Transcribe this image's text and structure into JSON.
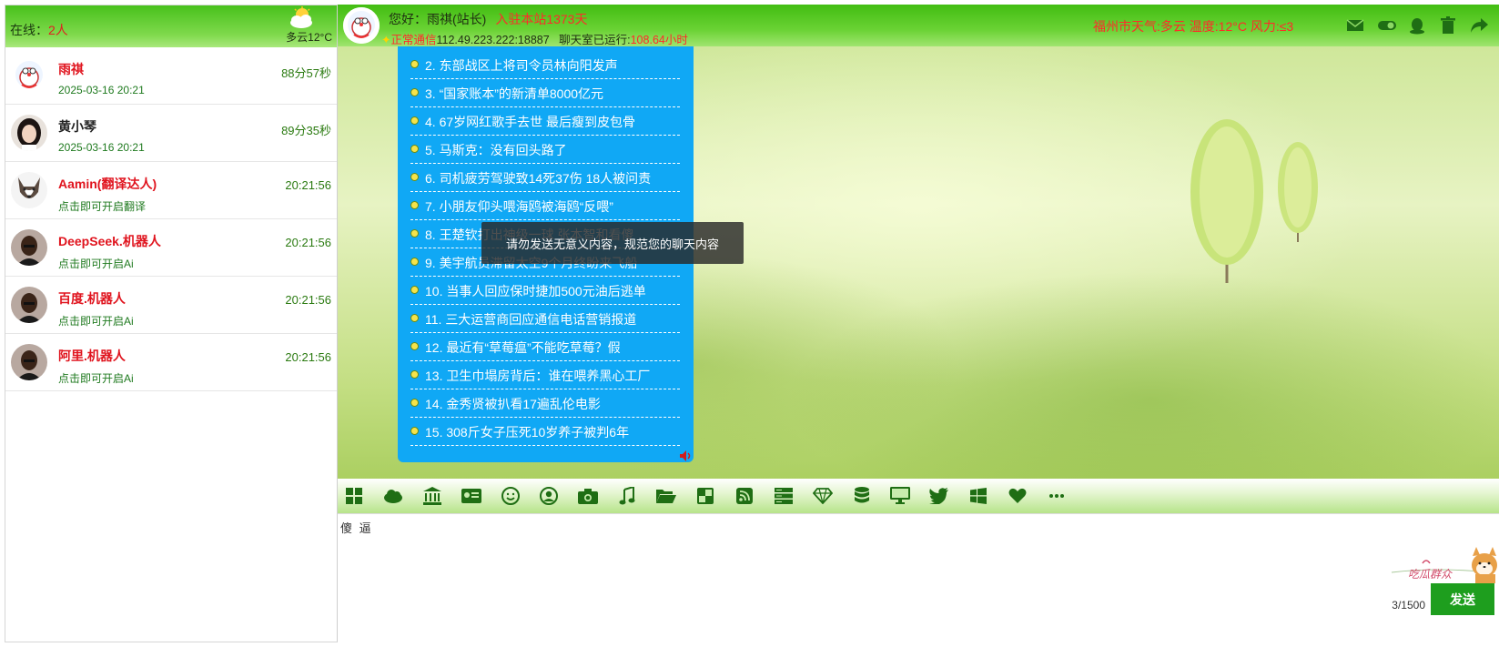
{
  "sidebar": {
    "online_label": "在线：",
    "online_count": "2人",
    "weather": "多云12°C",
    "users": [
      {
        "name": "雨祺",
        "sub": "2025-03-16 20:21",
        "time": "88分57秒",
        "name_color": "red"
      },
      {
        "name": "黄小琴",
        "sub": "2025-03-16 20:21",
        "time": "89分35秒",
        "name_color": "black"
      },
      {
        "name": "Aamin(翻译达人)",
        "sub": "点击即可开启翻译",
        "time": "20:21:56",
        "name_color": "red"
      },
      {
        "name": "DeepSeek.机器人",
        "sub": "点击即可开启Ai",
        "time": "20:21:56",
        "name_color": "red"
      },
      {
        "name": "百度.机器人",
        "sub": "点击即可开启Ai",
        "time": "20:21:56",
        "name_color": "red"
      },
      {
        "name": "阿里.机器人",
        "sub": "点击即可开启Ai",
        "time": "20:21:56",
        "name_color": "red"
      }
    ]
  },
  "header": {
    "greeting": "您好：雨祺(站长)",
    "days": "入驻本站1373天",
    "status_ok": "正常通信",
    "ip": "112.49.223.222:18887",
    "runtime_label": "聊天室已运行:",
    "runtime_value": "108.64小时",
    "weather_line": "福州市天气:多云 温度:12°C 风力:≤3",
    "tool_icons": [
      "mail-icon",
      "toggle-icon",
      "qq-icon",
      "trash-icon",
      "share-icon"
    ]
  },
  "news": [
    "2. 东部战区上将司令员林向阳发声",
    "3. “国家账本”的新清单8000亿元",
    "4. 67岁网红歌手去世 最后瘦到皮包骨",
    "5. 马斯克：没有回头路了",
    "6. 司机疲劳驾驶致14死37伤 18人被问责",
    "7. 小朋友仰头喂海鸥被海鸥“反喂”",
    "8. 王楚钦打出神级一球 张本智和看傻",
    "9. 美宇航员滞留太空9个月终盼来飞船",
    "10. 当事人回应保时捷加500元油后逃单",
    "11. 三大运营商回应通信电话营销报道",
    "12. 最近有“草莓瘟”不能吃草莓？假",
    "13. 卫生巾塌房背后：谁在喂养黑心工厂",
    "14. 金秀贤被扒看17遍乱伦电影",
    "15. 308斤女子压死10岁养子被判6年"
  ],
  "toast": "请勿发送无意义内容，规范您的聊天内容",
  "toolbar_icons": [
    "grid-icon",
    "cloud-icon",
    "bank-icon",
    "id-card-icon",
    "smile-icon",
    "user-circle-icon",
    "camera-icon",
    "music-icon",
    "folder-open-icon",
    "puzzle-icon",
    "rss-icon",
    "server-icon",
    "diamond-icon",
    "database-icon",
    "monitor-icon",
    "twitter-icon",
    "windows-icon",
    "heart-icon",
    "more-icon"
  ],
  "input": {
    "text": "傻 逼",
    "char_count": "3/1500",
    "send_label": "发送",
    "mascot_text": "吃瓜群众"
  },
  "colors": {
    "accent_green": "#42bd12",
    "news_blue": "#10a8f5",
    "alert_red": "#ff2a2a",
    "send_green": "#1e9e1e"
  }
}
